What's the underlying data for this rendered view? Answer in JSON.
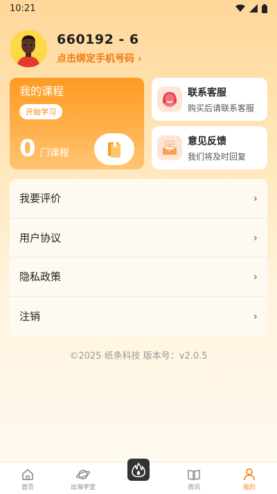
{
  "status_bar": {
    "time": "10:21"
  },
  "profile": {
    "username": "660192 - 6",
    "bind_phone": "点击绑定手机号码 ›"
  },
  "course_card": {
    "title": "我的课程",
    "start_button": "开始学习",
    "count": "0",
    "unit": "门课程"
  },
  "support_card": {
    "title": "联系客服",
    "subtitle": "购买后请联系客服",
    "icon": "headset-icon"
  },
  "feedback_card": {
    "title": "意见反馈",
    "subtitle": "我们将及时回复",
    "icon": "mail-icon"
  },
  "menu": {
    "items": [
      {
        "label": "我要评价"
      },
      {
        "label": "用户协议"
      },
      {
        "label": "隐私政策"
      },
      {
        "label": "注销"
      }
    ]
  },
  "copyright": "©2025 纸条科技 版本号：v2.0.5",
  "bottom_nav": {
    "items": [
      {
        "label": "首页",
        "icon": "home-icon"
      },
      {
        "label": "出海学堂",
        "icon": "planet-icon"
      },
      {
        "label": "",
        "icon": "flame-icon"
      },
      {
        "label": "资讯",
        "icon": "book-icon"
      },
      {
        "label": "我的",
        "icon": "user-icon"
      }
    ],
    "active_index": 4
  },
  "colors": {
    "accent": "#f08a1a",
    "card_orange": "#ff9a22",
    "background_top": "#ffd79a"
  }
}
